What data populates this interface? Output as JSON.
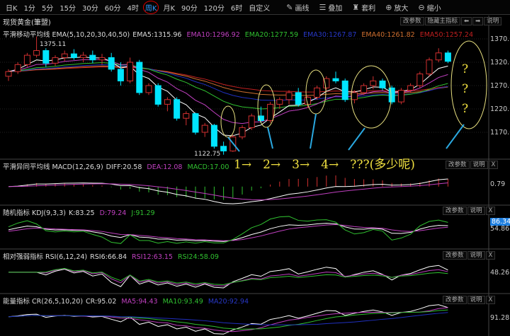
{
  "toolbar": {
    "timeframes": [
      "日K",
      "1分",
      "5分",
      "15分",
      "30分",
      "60分",
      "4时",
      "周K",
      "月K",
      "90分",
      "120分",
      "6时",
      "自定义"
    ],
    "active": "周K",
    "tools": [
      {
        "icon": "pencil-icon",
        "label": "画线"
      },
      {
        "icon": "stack-icon",
        "label": "叠加"
      },
      {
        "icon": "money-bag-icon",
        "label": "套利"
      },
      {
        "icon": "zoom-in-icon",
        "label": "放大"
      },
      {
        "icon": "zoom-out-icon",
        "label": "缩小"
      }
    ]
  },
  "title": "现货黄金(筆盟)",
  "main": {
    "label": "平滑移动平均线 EMA(5,10,20,30,40,50)",
    "ema5": "EMA5:1315.96",
    "ema10": "EMA10:1296.92",
    "ema20": "EMA20:1277.59",
    "ema30": "EMA30:1267.87",
    "ema40": "EMA40:1261.82",
    "ema50": "EMA50:1257.24",
    "buttons": [
      "改参数",
      "隐藏主指标",
      "⬅",
      "➡",
      "说明"
    ],
    "axis": [
      "1370.00",
      "1320.00",
      "1270.00",
      "1220.00",
      "1170.00"
    ],
    "high_label": "1375.11",
    "low_label": "1122.75",
    "annotations": [
      "1→",
      "2→",
      "3→",
      "4→",
      "???(多少呢)"
    ],
    "question_marks": [
      "?",
      "?",
      "?"
    ]
  },
  "macd": {
    "label": "平滑异同平均线 MACD(12,26,9)",
    "diff": "DIFF:20.58",
    "dea": "DEA:12.08",
    "macd": "MACD:17.00",
    "buttons": [
      "改参数",
      "说明",
      "X"
    ],
    "axis": "0.79"
  },
  "kdj": {
    "label": "随机指标 KDJ(9,3,3)",
    "k": "K:83.25",
    "d": "D:79.24",
    "j": "J:91.29",
    "buttons": [
      "改参数",
      "说明",
      "X"
    ],
    "axis_highlight": "86.34",
    "axis": "54.86"
  },
  "rsi": {
    "label": "相对强弱指标 RSI(6,12,24)",
    "rsi6": "RSI6:66.84",
    "rsi12": "RSI12:63.15",
    "rsi24": "RSI24:58.09",
    "buttons": [
      "改参数",
      "说明",
      "X"
    ],
    "axis": "48.26"
  },
  "cr": {
    "label": "能量指标 CR(26,5,10,20)",
    "cr": "CR:95.02",
    "ma5": "MA5:94.43",
    "ma10": "MA10:93.49",
    "ma20": "MA20:92.94",
    "buttons": [
      "改参数",
      "说明",
      "X"
    ],
    "axis": "91.28"
  },
  "colors": {
    "up": "#d23030",
    "down": "#00e5ff",
    "ema5": "#ffffff",
    "ema10": "#c040c0",
    "ema20": "#30c030",
    "ema30": "#2030c0",
    "ema40": "#d07030",
    "ema50": "#c02020",
    "annotation": "#f0e040",
    "arrow_line": "#2aa8e0"
  },
  "chart_data": {
    "type": "candlestick",
    "title": "现货黄金 周K",
    "ylim": [
      1110,
      1385
    ],
    "candles": [
      [
        1290,
        1305,
        1280,
        1300
      ],
      [
        1300,
        1320,
        1295,
        1315
      ],
      [
        1315,
        1340,
        1310,
        1335
      ],
      [
        1335,
        1375,
        1330,
        1345
      ],
      [
        1345,
        1350,
        1310,
        1318
      ],
      [
        1318,
        1335,
        1312,
        1330
      ],
      [
        1330,
        1345,
        1322,
        1338
      ],
      [
        1338,
        1348,
        1325,
        1330
      ],
      [
        1330,
        1342,
        1320,
        1335
      ],
      [
        1335,
        1345,
        1318,
        1325
      ],
      [
        1325,
        1338,
        1315,
        1330
      ],
      [
        1330,
        1340,
        1300,
        1305
      ],
      [
        1305,
        1320,
        1270,
        1280
      ],
      [
        1280,
        1330,
        1275,
        1320
      ],
      [
        1320,
        1325,
        1250,
        1255
      ],
      [
        1255,
        1275,
        1250,
        1270
      ],
      [
        1270,
        1275,
        1225,
        1230
      ],
      [
        1230,
        1245,
        1215,
        1240
      ],
      [
        1240,
        1245,
        1195,
        1200
      ],
      [
        1200,
        1215,
        1185,
        1210
      ],
      [
        1210,
        1212,
        1165,
        1170
      ],
      [
        1170,
        1190,
        1160,
        1185
      ],
      [
        1185,
        1188,
        1135,
        1140
      ],
      [
        1140,
        1150,
        1122,
        1130
      ],
      [
        1130,
        1165,
        1128,
        1160
      ],
      [
        1160,
        1185,
        1155,
        1180
      ],
      [
        1180,
        1210,
        1175,
        1205
      ],
      [
        1205,
        1225,
        1190,
        1195
      ],
      [
        1195,
        1235,
        1190,
        1230
      ],
      [
        1230,
        1245,
        1220,
        1240
      ],
      [
        1240,
        1260,
        1230,
        1255
      ],
      [
        1255,
        1265,
        1225,
        1230
      ],
      [
        1230,
        1250,
        1222,
        1245
      ],
      [
        1245,
        1270,
        1240,
        1265
      ],
      [
        1265,
        1290,
        1260,
        1285
      ],
      [
        1285,
        1300,
        1275,
        1280
      ],
      [
        1280,
        1285,
        1235,
        1240
      ],
      [
        1240,
        1260,
        1232,
        1255
      ],
      [
        1255,
        1275,
        1250,
        1270
      ],
      [
        1270,
        1290,
        1262,
        1280
      ],
      [
        1280,
        1285,
        1260,
        1265
      ],
      [
        1265,
        1270,
        1230,
        1235
      ],
      [
        1235,
        1265,
        1230,
        1260
      ],
      [
        1260,
        1275,
        1255,
        1270
      ],
      [
        1270,
        1300,
        1265,
        1295
      ],
      [
        1295,
        1330,
        1290,
        1325
      ],
      [
        1325,
        1350,
        1320,
        1340
      ],
      [
        1340,
        1345,
        1318,
        1322
      ]
    ]
  }
}
